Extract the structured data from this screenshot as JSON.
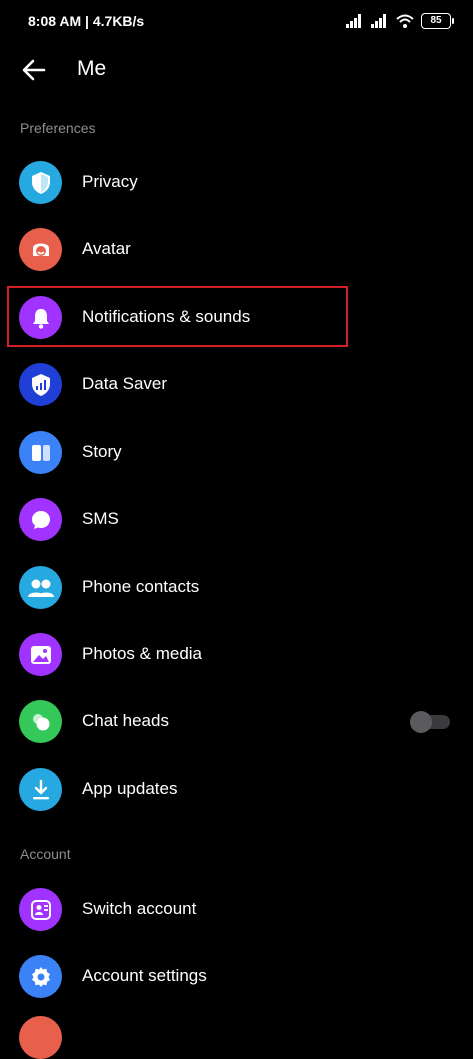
{
  "status_bar": {
    "text": "8:08 AM | 4.7KB/s",
    "battery": "85"
  },
  "header": {
    "title": "Me"
  },
  "sections": {
    "preferences": "Preferences",
    "account": "Account"
  },
  "items": [
    {
      "label": "Privacy",
      "icon": "shield-icon",
      "color": "#26a9e0"
    },
    {
      "label": "Avatar",
      "icon": "avatar-icon",
      "color": "#e8604c"
    },
    {
      "label": "Notifications & sounds",
      "icon": "bell-icon",
      "color": "#a033ff"
    },
    {
      "label": "Data Saver",
      "icon": "data-saver-icon",
      "color": "#1f3fd6"
    },
    {
      "label": "Story",
      "icon": "story-icon",
      "color": "#3b82f6"
    },
    {
      "label": "SMS",
      "icon": "chat-bubble-icon",
      "color": "#a033ff"
    },
    {
      "label": "Phone contacts",
      "icon": "contacts-icon",
      "color": "#26a9e0"
    },
    {
      "label": "Photos & media",
      "icon": "photo-icon",
      "color": "#a033ff"
    },
    {
      "label": "Chat heads",
      "icon": "chat-heads-icon",
      "color": "#34c759",
      "toggle": false
    },
    {
      "label": "App updates",
      "icon": "download-icon",
      "color": "#26a9e0"
    },
    {
      "label": "Switch account",
      "icon": "switch-account-icon",
      "color": "#a033ff"
    },
    {
      "label": "Account settings",
      "icon": "gear-icon",
      "color": "#3b82f6"
    }
  ],
  "colors": {
    "highlight": "#d32027",
    "background": "#000000"
  }
}
